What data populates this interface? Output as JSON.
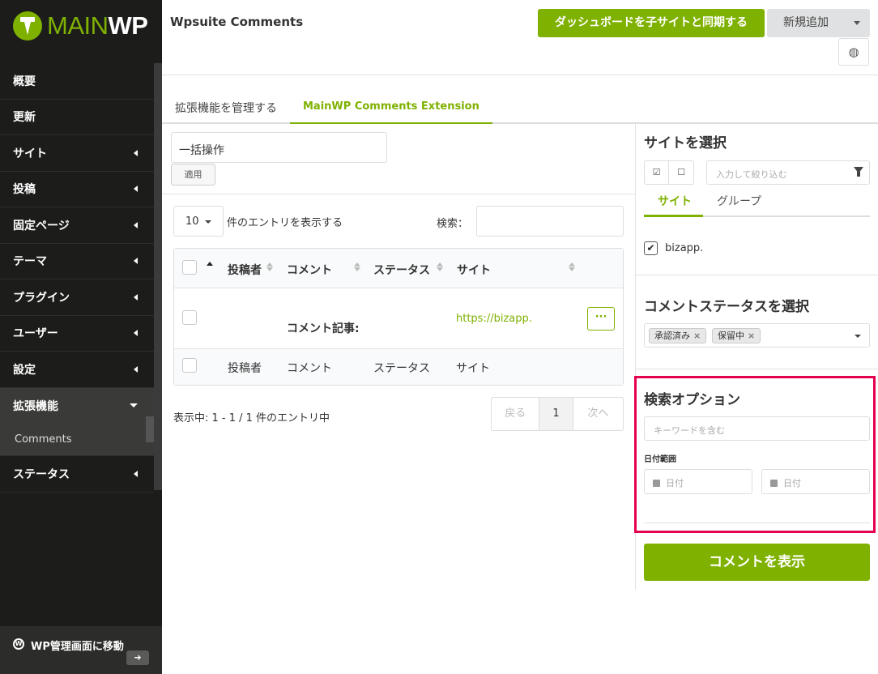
{
  "brand": {
    "logo_main": "MAIN",
    "logo_wp": "WP",
    "accent": "#7fb100",
    "sidebar_bg": "#1c1d1b",
    "highlight": "#e5004f"
  },
  "sidebar": {
    "items": [
      {
        "label": "概要",
        "caret": false
      },
      {
        "label": "更新",
        "caret": false
      },
      {
        "label": "サイト",
        "caret": true
      },
      {
        "label": "投稿",
        "caret": true
      },
      {
        "label": "固定ページ",
        "caret": true
      },
      {
        "label": "テーマ",
        "caret": true
      },
      {
        "label": "プラグイン",
        "caret": true
      },
      {
        "label": "ユーザー",
        "caret": true
      },
      {
        "label": "設定",
        "caret": true
      },
      {
        "label": "拡張機能",
        "caret": true,
        "open": true
      },
      {
        "label": "ステータス",
        "caret": true
      }
    ],
    "sub_item": "Comments",
    "wp_admin_link": "WP管理画面に移動",
    "wp_logo": "W"
  },
  "header": {
    "title": "Wpsuite Comments",
    "sync_button": "ダッシュボードを子サイトと同期する",
    "add_button": "新規追加",
    "globe_icon": "globe-icon"
  },
  "tabs": [
    "拡張機能を管理する",
    "MainWP Comments Extension"
  ],
  "bulk": {
    "select_value": "一括操作",
    "apply_button": "適用"
  },
  "table_controls": {
    "length_value": "10",
    "length_label": "件のエントリを表示する",
    "search_label": "検索："
  },
  "table": {
    "headers": [
      "投稿者",
      "コメント",
      "ステータス",
      "サイト"
    ],
    "row": {
      "author": "",
      "comment": "コメント記事:",
      "status": "",
      "site": "https://bizapp.",
      "more": "···"
    },
    "footers": [
      "投稿者",
      "コメント",
      "ステータス",
      "サイト"
    ]
  },
  "pagination": {
    "info": "表示中: 1 - 1 / 1 件のエントリ中",
    "prev": "戻る",
    "current": "1",
    "next": "次へ"
  },
  "right_panel": {
    "select_site_title": "サイトを選択",
    "filter_placeholder": "入力して絞り込む",
    "tab_site": "サイト",
    "tab_group": "グループ",
    "site_name": "bizapp.",
    "site_checked": true,
    "status_title": "コメントステータスを選択",
    "status_chips": [
      "承認済み",
      "保留中"
    ],
    "search_title": "検索オプション",
    "keyword_placeholder": "キーワードを含む",
    "date_label": "日付範囲",
    "date_from_placeholder": "日付",
    "date_to_placeholder": "日付",
    "show_button": "コメントを表示"
  }
}
